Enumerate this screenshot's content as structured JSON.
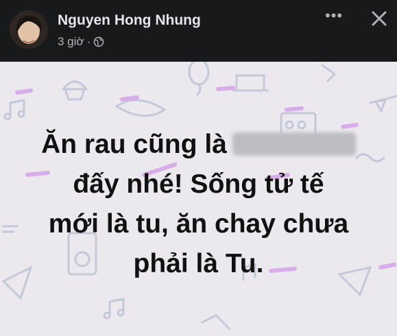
{
  "post": {
    "author": "Nguyen Hong Nhung",
    "time": "3 giờ",
    "audience_icon": "globe-icon",
    "lines": [
      "Ăn rau cũng là",
      "đấy nhé! Sống tử tế",
      "mới là tu, ăn chay chưa",
      "phải là Tu."
    ],
    "background_color": "#ebe9ee"
  },
  "actions": {
    "more_icon": "more-options-icon",
    "more_label": "•••",
    "close_icon": "close-icon"
  }
}
